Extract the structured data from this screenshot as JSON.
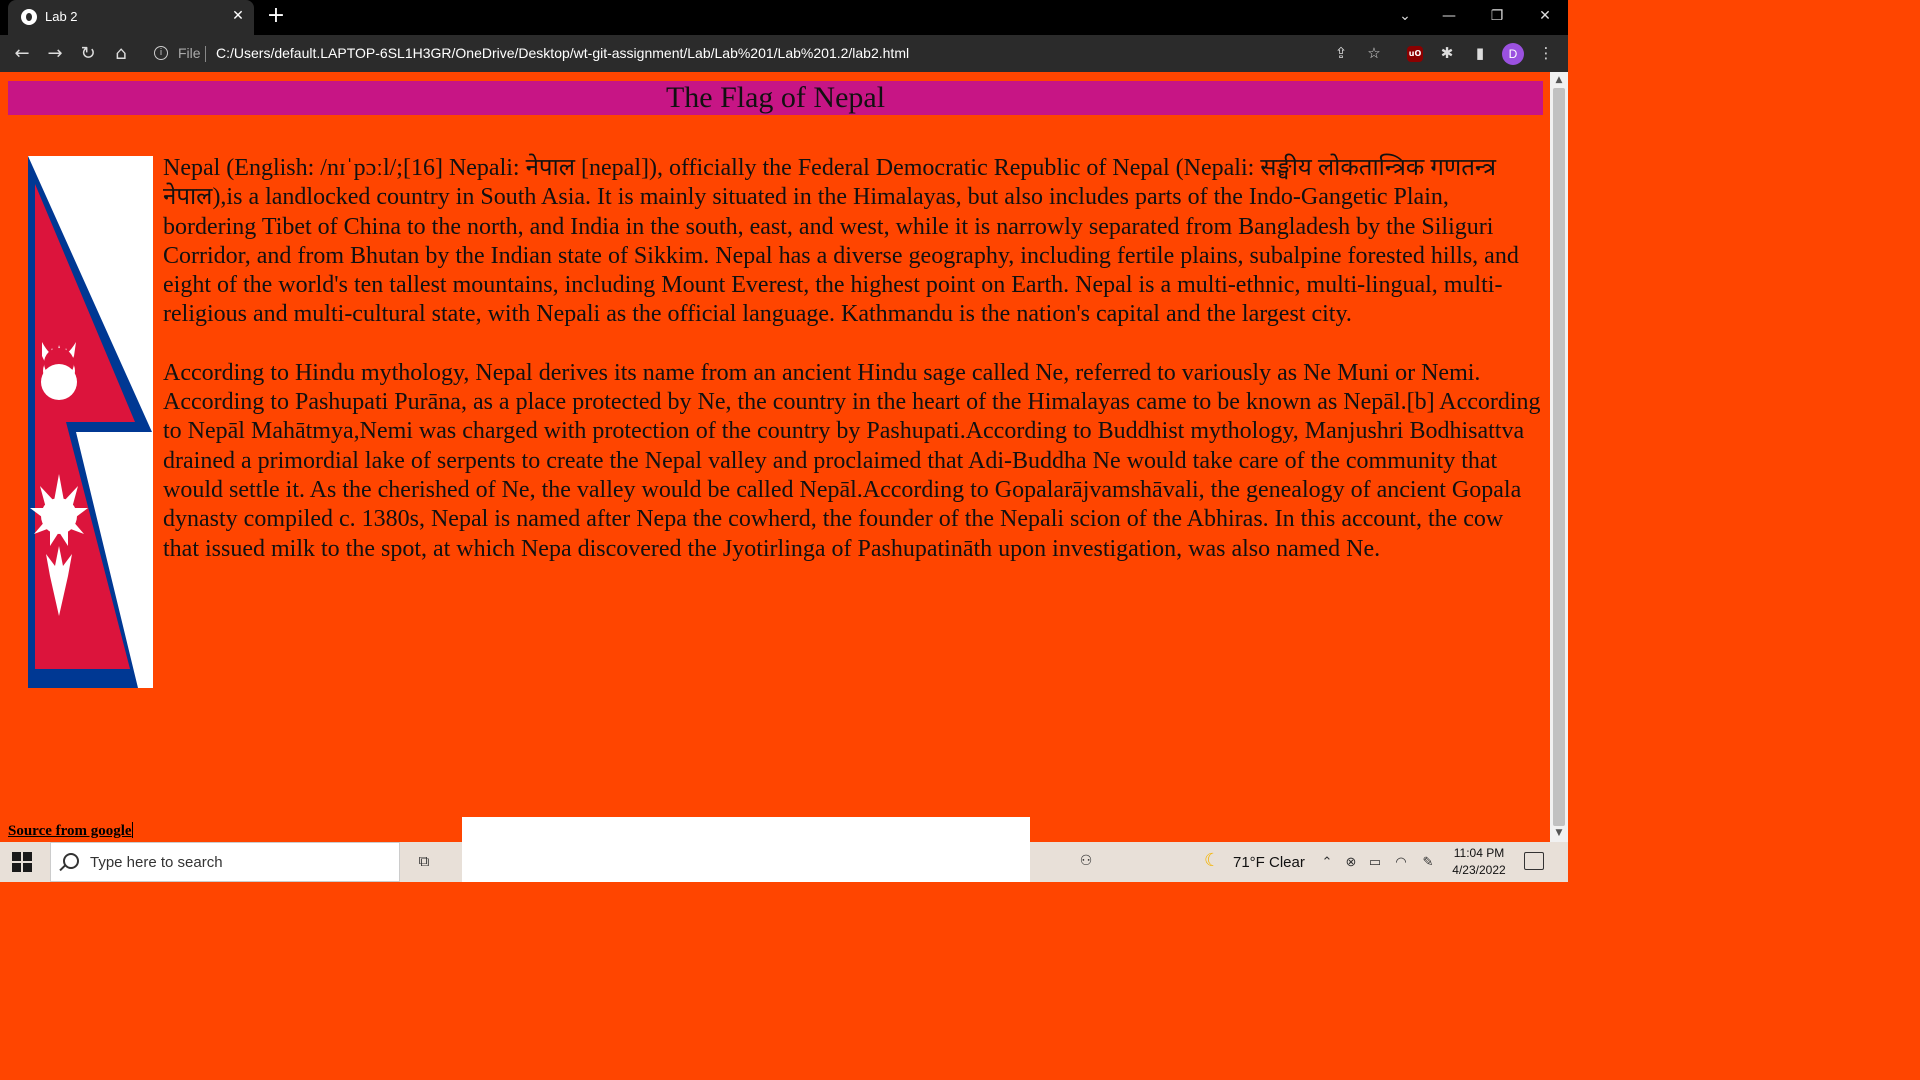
{
  "browser": {
    "tab_title": "Lab 2",
    "file_label": "File",
    "url": "C:/Users/default.LAPTOP-6SL1H3GR/OneDrive/Desktop/wt-git-assignment/Lab/Lab%201/Lab%201.2/lab2.html",
    "profile_initial": "D",
    "extension_label": "uO"
  },
  "page": {
    "title": "The Flag of Nepal",
    "paragraph_1": "Nepal (English: /nɪˈpɔːl/;[16] Nepali: नेपाल [nepal]), officially the Federal Democratic Republic of Nepal (Nepali: सङ्घीय लोकतान्त्रिक गणतन्त्र नेपाल),is a landlocked country in South Asia. It is mainly situated in the Himalayas, but also includes parts of the Indo-Gangetic Plain, bordering Tibet of China to the north, and India in the south, east, and west, while it is narrowly separated from Bangladesh by the Siliguri Corridor, and from Bhutan by the Indian state of Sikkim. Nepal has a diverse geography, including fertile plains, subalpine forested hills, and eight of the world's ten tallest mountains, including Mount Everest, the highest point on Earth. Nepal is a multi-ethnic, multi-lingual, multi-religious and multi-cultural state, with Nepali as the official language. Kathmandu is the nation's capital and the largest city.",
    "paragraph_2": "According to Hindu mythology, Nepal derives its name from an ancient Hindu sage called Ne, referred to variously as Ne Muni or Nemi. According to Pashupati Purāna, as a place protected by Ne, the country in the heart of the Himalayas came to be known as Nepāl.[b] According to Nepāl Mahātmya,Nemi was charged with protection of the country by Pashupati.According to Buddhist mythology, Manjushri Bodhisattva drained a primordial lake of serpents to create the Nepal valley and proclaimed that Adi-Buddha Ne would take care of the community that would settle it. As the cherished of Ne, the valley would be called Nepāl.According to Gopalarājvamshāvali, the genealogy of ancient Gopala dynasty compiled c. 1380s, Nepal is named after Nepa the cowherd, the founder of the Nepali scion of the Abhiras. In this account, the cow that issued milk to the spot, at which Nepa discovered the Jyotirlinga of Pashupatināth upon investigation, was also named Ne.",
    "source_link": "Source from google"
  },
  "colors": {
    "page_background": "#ff4500",
    "title_background": "#c71585",
    "flag_red": "#dc143c",
    "flag_blue": "#003893"
  },
  "taskbar": {
    "search_placeholder": "Type here to search",
    "weather": "71°F  Clear",
    "time": "11:04 PM",
    "date": "4/23/2022"
  }
}
